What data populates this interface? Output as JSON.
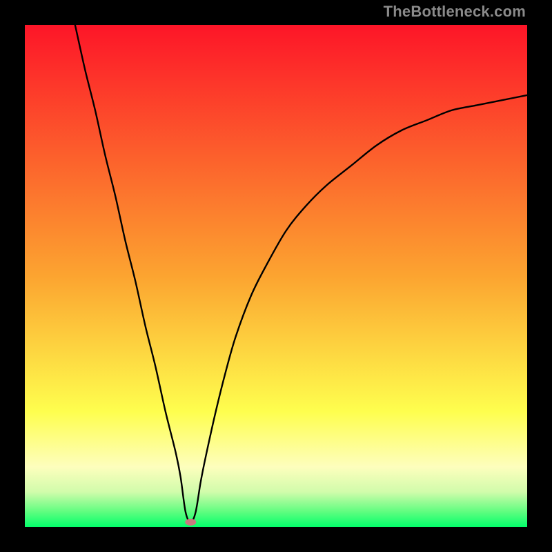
{
  "watermark": "TheBottleneck.com",
  "chart_data": {
    "type": "line",
    "title": "",
    "xlabel": "",
    "ylabel": "",
    "xlim": [
      0,
      100
    ],
    "ylim": [
      0,
      100
    ],
    "series": [
      {
        "name": "bottleneck-curve",
        "x": [
          10,
          12,
          14,
          16,
          18,
          20,
          22,
          24,
          26,
          28,
          30,
          31,
          32,
          33,
          34,
          35,
          36,
          38,
          40,
          42,
          45,
          48,
          52,
          56,
          60,
          65,
          70,
          75,
          80,
          85,
          90,
          95,
          100
        ],
        "values": [
          100,
          91,
          83,
          74,
          66,
          57,
          49,
          40,
          32,
          23,
          15,
          10,
          3,
          1,
          3,
          9,
          14,
          23,
          31,
          38,
          46,
          52,
          59,
          64,
          68,
          72,
          76,
          79,
          81,
          83,
          84,
          85,
          86
        ]
      }
    ],
    "minimum_point": {
      "x": 33,
      "y": 1
    },
    "gradient_stops": [
      {
        "pct": 0,
        "color": "#fd1528"
      },
      {
        "pct": 50,
        "color": "#fca430"
      },
      {
        "pct": 77,
        "color": "#fefe4e"
      },
      {
        "pct": 88,
        "color": "#fdfebd"
      },
      {
        "pct": 93,
        "color": "#d1fcab"
      },
      {
        "pct": 97,
        "color": "#5dfd7f"
      },
      {
        "pct": 100,
        "color": "#02ff6b"
      }
    ]
  }
}
